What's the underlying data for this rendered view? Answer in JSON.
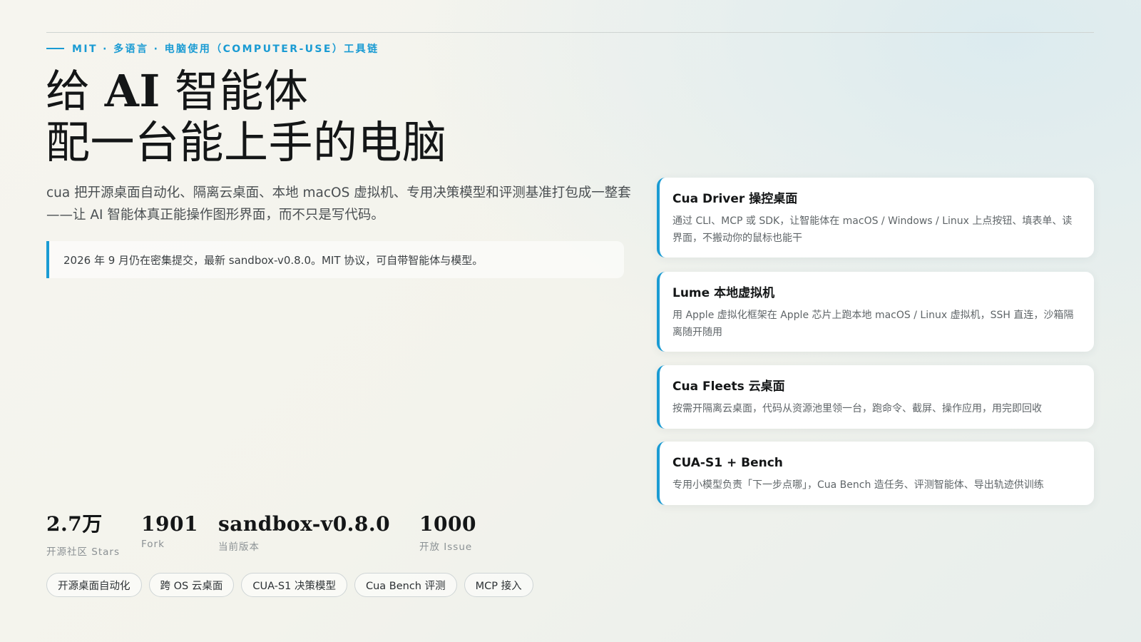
{
  "eyebrow": "MIT · 多语言 · 电脑使用（COMPUTER-USE）工具链",
  "hero": {
    "title_prefix": "给 ",
    "title_ai": "AI",
    "title_suffix": " 智能体",
    "title_line2": "配一台能上手的电脑"
  },
  "lede": "cua 把开源桌面自动化、隔离云桌面、本地 macOS 虚拟机、专用决策模型和评测基准打包成一整套——让 AI 智能体真正能操作图形界面，而不只是写代码。",
  "notice": "2026 年 9 月仍在密集提交，最新 sandbox-v0.8.0。MIT 协议，可自带智能体与模型。",
  "stats": [
    {
      "value": "2.7万",
      "label": "开源社区 Stars"
    },
    {
      "value": "1901",
      "label": "Fork"
    },
    {
      "value": "sandbox-v0.8.0",
      "label": "当前版本"
    },
    {
      "value": "1000",
      "label": "开放 Issue"
    }
  ],
  "chips": [
    "开源桌面自动化",
    "跨 OS 云桌面",
    "CUA-S1 决策模型",
    "Cua Bench 评测",
    "MCP 接入"
  ],
  "cards": [
    {
      "title": "Cua Driver 操控桌面",
      "desc": "通过 CLI、MCP 或 SDK，让智能体在 macOS / Windows / Linux 上点按钮、填表单、读界面，不搬动你的鼠标也能干"
    },
    {
      "title": "Lume 本地虚拟机",
      "desc": "用 Apple 虚拟化框架在 Apple 芯片上跑本地 macOS / Linux 虚拟机，SSH 直连，沙箱隔离随开随用"
    },
    {
      "title": "Cua Fleets 云桌面",
      "desc": "按需开隔离云桌面，代码从资源池里领一台，跑命令、截屏、操作应用，用完即回收"
    },
    {
      "title": "CUA-S1 + Bench",
      "desc": "专用小模型负责「下一步点哪」，Cua Bench 造任务、评测智能体、导出轨迹供训练"
    }
  ],
  "colors": {
    "accent": "#1a9bd3",
    "ink": "#141617",
    "muted": "#8b9194"
  }
}
